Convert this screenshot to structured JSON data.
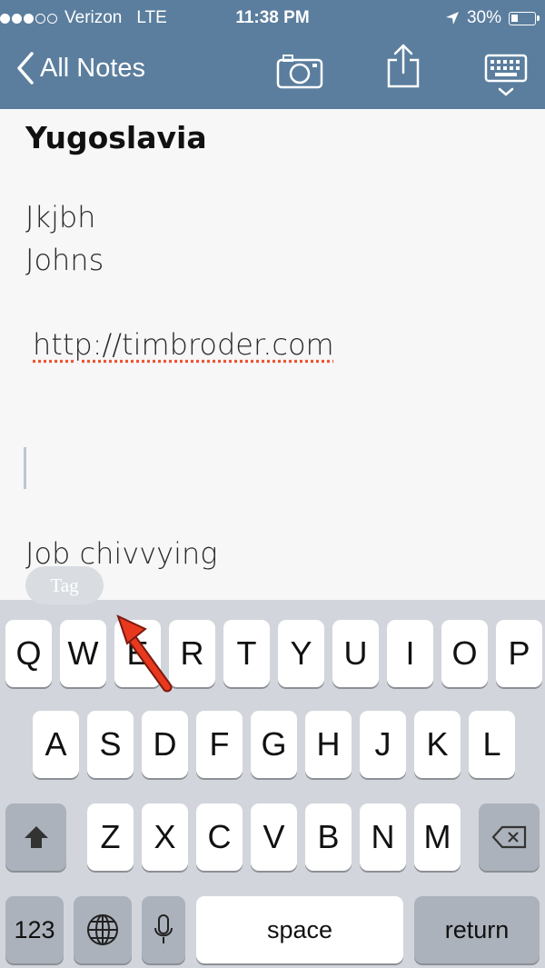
{
  "status_bar": {
    "carrier": "Verizon",
    "network": "LTE",
    "time": "11:38 PM",
    "battery": "30%",
    "battery_level": 0.3,
    "signal_bars": 3
  },
  "nav": {
    "back_label": "All Notes",
    "icons": [
      "camera-icon",
      "share-icon",
      "keyboard-dismiss-icon"
    ]
  },
  "note": {
    "title": "Yugoslavia",
    "lines": [
      "Jkjbh",
      "Johns",
      "http://timbroder.com",
      "Job chivvying"
    ]
  },
  "tag_button": "Tag",
  "keyboard": {
    "row1": [
      "Q",
      "W",
      "E",
      "R",
      "T",
      "Y",
      "U",
      "I",
      "O",
      "P"
    ],
    "row2": [
      "A",
      "S",
      "D",
      "F",
      "G",
      "H",
      "J",
      "K",
      "L"
    ],
    "row3": [
      "Z",
      "X",
      "C",
      "V",
      "B",
      "N",
      "M"
    ],
    "numbers_label": "123",
    "space_label": "space",
    "return_label": "return"
  },
  "colors": {
    "nav_bg": "#5b7e9e",
    "keyboard_bg": "#d2d5db",
    "annotation_arrow": "#e8391f"
  }
}
